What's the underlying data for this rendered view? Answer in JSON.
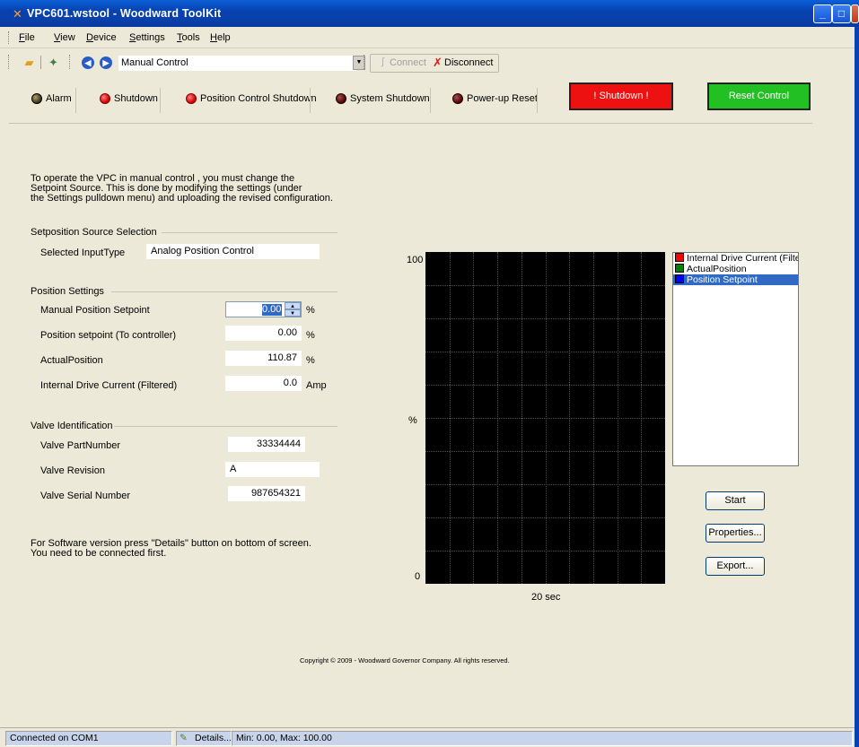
{
  "window": {
    "title": "VPC601.wstool - Woodward ToolKit"
  },
  "menu": [
    {
      "label": "File",
      "u": "F",
      "rest": "ile"
    },
    {
      "label": "View",
      "u": "V",
      "rest": "iew"
    },
    {
      "label": "Device",
      "u": "D",
      "rest": "evice"
    },
    {
      "label": "Settings",
      "u": "S",
      "rest": "ettings"
    },
    {
      "label": "Tools",
      "u": "T",
      "rest": "ools"
    },
    {
      "label": "Help",
      "u": "H",
      "rest": "elp"
    }
  ],
  "toolbar": {
    "page_selector": "Manual Control",
    "connect_label": "Connect",
    "disconnect_label": "Disconnect"
  },
  "status_indicators": [
    {
      "label": "Alarm",
      "state": "off"
    },
    {
      "label": "Shutdown",
      "state": "on"
    },
    {
      "label": "Position Control Shutdown",
      "state": "on"
    },
    {
      "label": "System Shutdown",
      "state": "off-red"
    },
    {
      "label": "Power-up Reset",
      "state": "off-red"
    }
  ],
  "buttons": {
    "shutdown": "! Shutdown !",
    "reset": "Reset Control",
    "start": "Start",
    "properties": "Properties...",
    "export": "Export...",
    "colors": {
      "shutdown": "#ee1111",
      "reset": "#22c022"
    }
  },
  "intro": {
    "line1": "To operate the VPC in manual control , you must change the",
    "line2": "Setpoint Source. This is done by modifying the settings (under",
    "line3": "the Settings pulldown menu) and uploading the revised configuration."
  },
  "source_selection": {
    "group": "Setposition Source Selection",
    "label": "Selected InputType",
    "value": "Analog Position Control"
  },
  "position_settings": {
    "group": "Position Settings",
    "manual_label": "Manual Position Setpoint",
    "manual_value": "0.00",
    "manual_unit": "%",
    "setpoint_label": "Position setpoint (To controller)",
    "setpoint_value": "0.00",
    "setpoint_unit": "%",
    "actual_label": "ActualPosition",
    "actual_value": "110.87",
    "actual_unit": "%",
    "current_label": "Internal Drive Current (Filtered)",
    "current_value": "0.0",
    "current_unit": "Amp"
  },
  "valve_identification": {
    "group": "Valve Identification",
    "part_label": "Valve PartNumber",
    "part_value": "33334444",
    "rev_label": "Valve Revision",
    "rev_value": "A",
    "serial_label": "Valve Serial Number",
    "serial_value": "987654321"
  },
  "software_note": {
    "line1": "For Software version press \"Details\" button on bottom of screen.",
    "line2": "You need to be connected first."
  },
  "trend": {
    "y_max": "100",
    "y_min": "0",
    "y_unit": "%",
    "x_label": "20 sec"
  },
  "legend": [
    {
      "name": "Internal Drive Current (Filtered)",
      "color": "#ff0000",
      "selected": false
    },
    {
      "name": "ActualPosition",
      "color": "#008000",
      "selected": false
    },
    {
      "name": "Position Setpoint",
      "color": "#0000ff",
      "selected": true
    }
  ],
  "copyright": "Copyright © 2009 - Woodward Governor Company.  All rights reserved.",
  "statusbar": {
    "connection": "Connected on COM1",
    "details": "Details...",
    "minmax": "Min: 0.00, Max: 100.00"
  }
}
